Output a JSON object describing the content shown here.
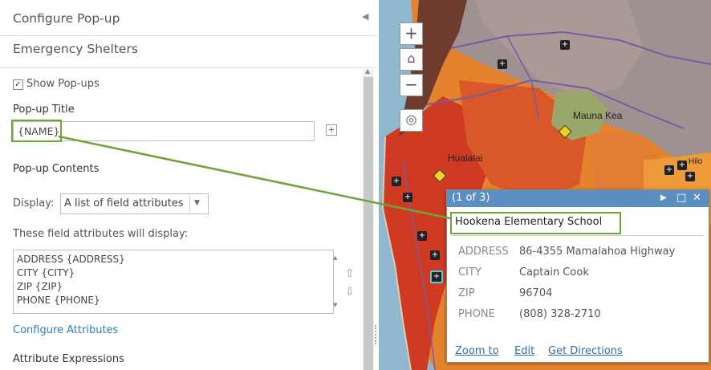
{
  "panel": {
    "title": "Configure Pop-up",
    "layer_name": "Emergency Shelters",
    "show_popups_label": "Show Pop-ups",
    "popup_title_label": "Pop-up Title",
    "popup_title_value": "{NAME}",
    "popup_contents_label": "Pop-up Contents",
    "display_label": "Display:",
    "display_value": "A list of field attributes",
    "fields_label": "These field attributes will display:",
    "fields": [
      "ADDRESS {ADDRESS}",
      "CITY {CITY}",
      "ZIP {ZIP}",
      "PHONE {PHONE}"
    ],
    "configure_attributes": "Configure Attributes",
    "attribute_expressions": "Attribute Expressions"
  },
  "map": {
    "places": [
      "Mauna Kea",
      "Hualalai",
      "Hilo"
    ],
    "zoom_in": "+",
    "zoom_out": "−"
  },
  "popup": {
    "count": "(1 of 3)",
    "title": "Hookena Elementary School",
    "fields": [
      {
        "key": "ADDRESS",
        "value": "86-4355 Mamalahoa Highway"
      },
      {
        "key": "CITY",
        "value": "Captain Cook"
      },
      {
        "key": "ZIP",
        "value": "96704"
      },
      {
        "key": "PHONE",
        "value": "(808) 328-2710"
      }
    ],
    "links": [
      "Zoom to",
      "Edit",
      "Get Directions"
    ]
  },
  "colors": {
    "highlight": "#6fa534",
    "popup_bar": "#5b8fc1",
    "link": "#2d6fad"
  }
}
